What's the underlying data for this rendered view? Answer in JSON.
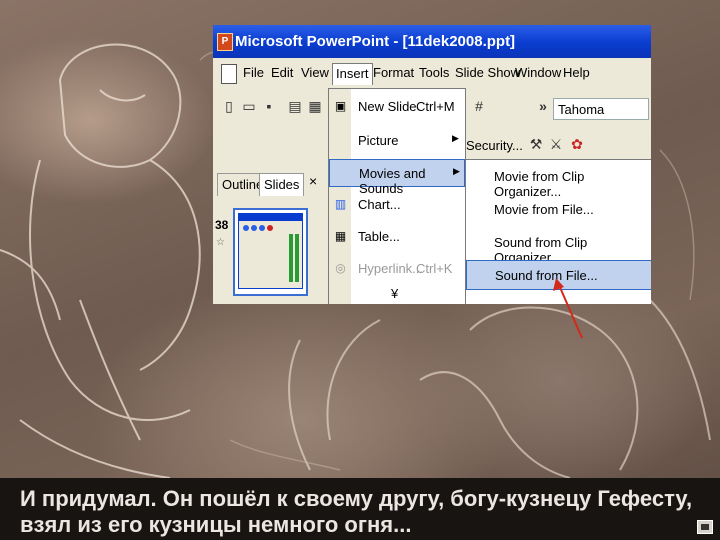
{
  "window": {
    "title": "Microsoft PowerPoint - [11dek2008.ppt]",
    "app_icon": "powerpoint-icon"
  },
  "menubar": {
    "items": [
      "File",
      "Edit",
      "View",
      "Insert",
      "Format",
      "Tools",
      "Slide Show",
      "Window",
      "Help"
    ],
    "open_item": "Insert"
  },
  "toolbar": {
    "font": "Tahoma",
    "overflow": "»",
    "security_label": "Security...",
    "icons": [
      "new-icon",
      "open-icon",
      "save-icon",
      "print-icon",
      "cut-icon"
    ]
  },
  "left_pane": {
    "tabs": [
      "Outline",
      "Slides"
    ],
    "active_tab": "Slides",
    "close": "×",
    "slide_number": "38",
    "slide_marker": "☆"
  },
  "insert_menu": {
    "items": [
      {
        "label": "New Slide",
        "shortcut": "Ctrl+M",
        "icon": "new-slide-icon"
      },
      {
        "label": "Picture",
        "submenu": true
      },
      {
        "label": "Movies and Sounds",
        "submenu": true,
        "highlighted": true
      },
      {
        "label": "Chart...",
        "icon": "chart-icon"
      },
      {
        "label": "Table...",
        "icon": "table-icon"
      },
      {
        "label": "Hyperlink...",
        "shortcut": "Ctrl+K",
        "icon": "hyperlink-icon",
        "disabled": true
      }
    ],
    "more": "¥"
  },
  "movies_submenu": {
    "items": [
      {
        "label": "Movie from Clip Organizer..."
      },
      {
        "label": "Movie from File..."
      },
      {
        "label": "Sound from Clip Organizer..."
      },
      {
        "label": "Sound from File...",
        "highlighted": true
      }
    ]
  },
  "subtitle": {
    "line1": "И придумал. Он пошёл к своему другу, богу-кузнецу Гефесту,",
    "line2": "взял из его кузницы немного огня..."
  },
  "colors": {
    "titlebar": "#0a3ccf",
    "menu_highlight": "#c1d2ee",
    "arrow": "#d22a1a",
    "subtitle_bg": "#181412"
  }
}
